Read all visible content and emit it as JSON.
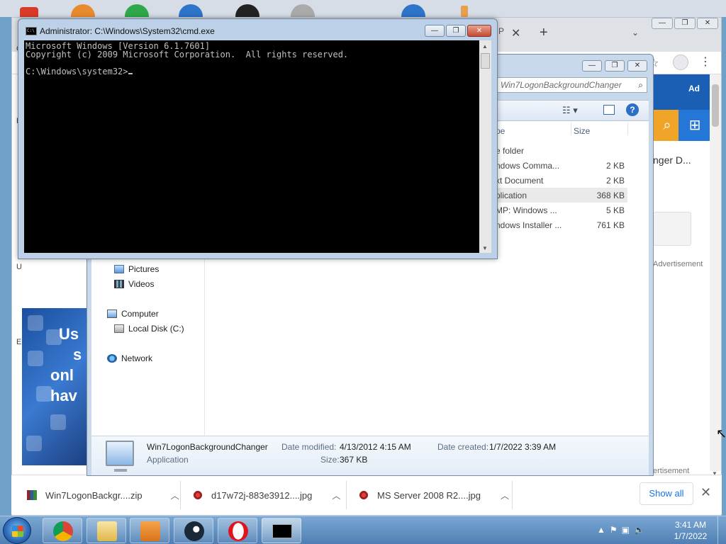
{
  "cmd": {
    "title": "Administrator: C:\\Windows\\System32\\cmd.exe",
    "lines": [
      "Microsoft Windows [Version 6.1.7601]",
      "Copyright (c) 2009 Microsoft Corporation.  All rights reserved.",
      "",
      "C:\\Windows\\system32>"
    ]
  },
  "explorer": {
    "search_placeholder": "ch Win7LogonBackgroundChanger",
    "columns": {
      "type": "pe",
      "size": "Size"
    },
    "rows": [
      {
        "type": "e folder",
        "size": ""
      },
      {
        "type": "ndows Comma...",
        "size": "2 KB"
      },
      {
        "type": "xt Document",
        "size": "2 KB"
      },
      {
        "type": "plication",
        "size": "368 KB",
        "selected": true
      },
      {
        "type": "MP: Windows ...",
        "size": "5 KB"
      },
      {
        "type": "ndows Installer ...",
        "size": "761 KB"
      }
    ],
    "nav": {
      "pictures": "Pictures",
      "videos": "Videos",
      "computer": "Computer",
      "local_disk": "Local Disk (C:)",
      "network": "Network"
    },
    "details": {
      "name": "Win7LogonBackgroundChanger",
      "type": "Application",
      "modified_label": "Date modified:",
      "modified_value": "4/13/2012 4:15 AM",
      "created_label": "Date created:",
      "created_value": "1/7/2022 3:39 AM",
      "size_label": "Size:",
      "size_value": "367 KB"
    }
  },
  "browser": {
    "tab_fragment": "P",
    "page_ad": "Ad",
    "page_title_fragment": "nger D...",
    "advertisement": "Advertisement",
    "advertisement2": "ertisement",
    "thumb_text": [
      "Us",
      "s",
      "onl",
      "hav"
    ],
    "side_letters": [
      "G",
      "R",
      "U",
      "E"
    ]
  },
  "downloads": {
    "items": [
      {
        "name": "Win7LogonBackgr....zip",
        "icon": "zip-archive-icon"
      },
      {
        "name": "d17w72j-883e3912....jpg",
        "icon": "image-file-icon"
      },
      {
        "name": "MS Server 2008 R2....jpg",
        "icon": "image-file-icon"
      }
    ],
    "show_all": "Show all"
  },
  "taskbar": {
    "time": "3:41 AM",
    "date": "1/7/2022",
    "apps": [
      "chrome",
      "explorer",
      "media-player",
      "steam",
      "opera",
      "cmd"
    ]
  },
  "colors": {
    "taskbar": "#4f7fb4",
    "console_bg": "#000000",
    "console_fg": "#c0c0c0",
    "link_blue": "#1a73e8"
  }
}
